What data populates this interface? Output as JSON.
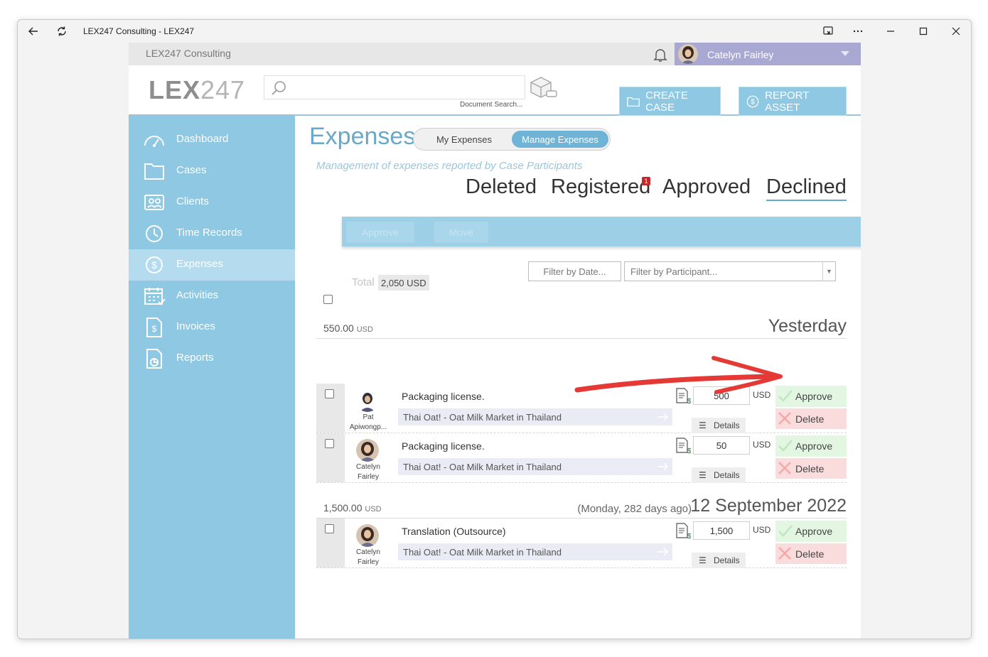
{
  "window": {
    "title": "LEX247 Consulting - LEX247"
  },
  "topbar": {
    "org_name": "LEX247 Consulting",
    "user_name": "Catelyn Fairley"
  },
  "header": {
    "logo_bold": "LEX",
    "logo_light": "247",
    "search_placeholder": "",
    "doc_search_label": "Document Search...",
    "create_case": "CREATE CASE",
    "report_asset": "REPORT ASSET"
  },
  "sidebar": {
    "items": [
      {
        "label": "Dashboard",
        "icon": "dashboard-icon"
      },
      {
        "label": "Cases",
        "icon": "folder-icon"
      },
      {
        "label": "Clients",
        "icon": "clients-icon"
      },
      {
        "label": "Time Records",
        "icon": "clock-icon"
      },
      {
        "label": "Expenses",
        "icon": "dollar-icon",
        "active": true
      },
      {
        "label": "Activities",
        "icon": "calendar-icon"
      },
      {
        "label": "Invoices",
        "icon": "invoice-icon"
      },
      {
        "label": "Reports",
        "icon": "report-icon"
      }
    ]
  },
  "page": {
    "title": "Expenses",
    "toggle": {
      "option1": "My Expenses",
      "option2": "Manage Expenses",
      "selected": "Manage Expenses"
    },
    "subtitle": "Management of expenses reported by Case Participants",
    "tabs": [
      {
        "label": "Deleted"
      },
      {
        "label": "Registered",
        "badge": "1"
      },
      {
        "label": "Approved"
      },
      {
        "label": "Declined",
        "active": true
      }
    ],
    "actions": {
      "approve": "Approve",
      "move": "Move"
    },
    "filters": {
      "date_placeholder": "Filter by Date...",
      "participant_placeholder": "Filter by Participant..."
    },
    "total_label": "Total",
    "total_value": "2,050 USD"
  },
  "groups": [
    {
      "sum": "550.00",
      "sum_currency": "USD",
      "date": "Yesterday",
      "ago": "",
      "rows": [
        {
          "participant": "Pat Apiwongp...",
          "description": "Packaging license.",
          "case": "Thai Oat! - Oat Milk Market in Thailand",
          "amount": "500",
          "currency": "USD",
          "details": "Details",
          "approve": "Approve",
          "delete": "Delete"
        },
        {
          "participant": "Catelyn Fairley",
          "description": "Packaging license.",
          "case": "Thai Oat! - Oat Milk Market in Thailand",
          "amount": "50",
          "currency": "USD",
          "details": "Details",
          "approve": "Approve",
          "delete": "Delete"
        }
      ]
    },
    {
      "sum": "1,500.00",
      "sum_currency": "USD",
      "date": "12 September 2022",
      "ago": "(Monday, 282 days ago)",
      "rows": [
        {
          "participant": "Catelyn Fairley",
          "description": "Translation (Outsource)",
          "case": "Thai Oat! - Oat Milk Market in Thailand",
          "amount": "1,500",
          "currency": "USD",
          "details": "Details",
          "approve": "Approve",
          "delete": "Delete"
        }
      ]
    }
  ],
  "colors": {
    "accent": "#8ec8e2",
    "title_blue": "#6aa8c9",
    "user_panel": "#a8a8d3",
    "approve_bg": "#e2f6e2",
    "delete_bg": "#fbdcdc",
    "annotation_red": "#e53935"
  }
}
